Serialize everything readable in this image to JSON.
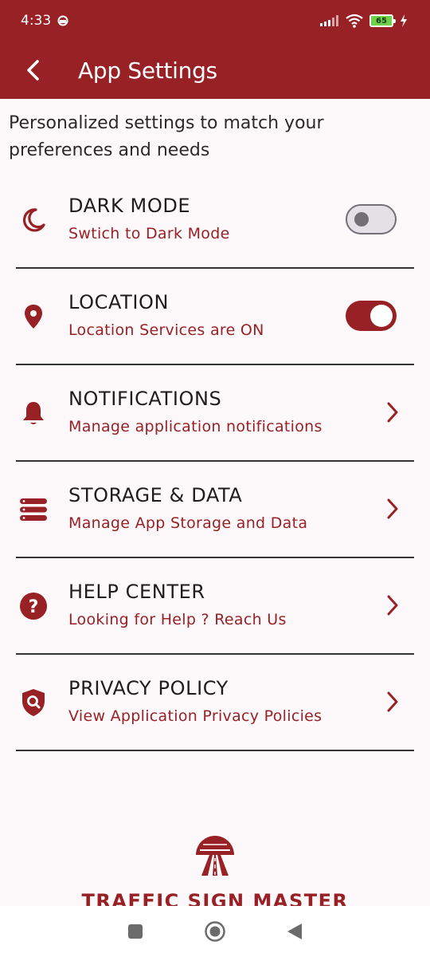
{
  "status_bar": {
    "time": "4:33",
    "battery": "65"
  },
  "app_bar": {
    "title": "App Settings"
  },
  "intro": "Personalized settings to match your preferences and needs",
  "settings": [
    {
      "title": "DARK MODE",
      "subtitle": "Swtich to Dark Mode",
      "icon": "moon-icon",
      "control": "toggle",
      "enabled": false
    },
    {
      "title": "LOCATION",
      "subtitle": "Location Services are ON",
      "icon": "location-pin-icon",
      "control": "toggle",
      "enabled": true
    },
    {
      "title": "NOTIFICATIONS",
      "subtitle": "Manage application notifications",
      "icon": "bell-icon",
      "control": "chevron"
    },
    {
      "title": "STORAGE & DATA",
      "subtitle": "Manage App Storage and Data",
      "icon": "storage-icon",
      "control": "chevron"
    },
    {
      "title": "HELP CENTER",
      "subtitle": "Looking for Help ? Reach Us",
      "icon": "help-icon",
      "control": "chevron"
    },
    {
      "title": "PRIVACY POLICY",
      "subtitle": "View Application Privacy Policies",
      "icon": "shield-search-icon",
      "control": "chevron"
    }
  ],
  "footer": {
    "brand": "TRAFFIC SIGN MASTER"
  },
  "colors": {
    "primary": "#982125",
    "background": "#fdf8fa"
  }
}
